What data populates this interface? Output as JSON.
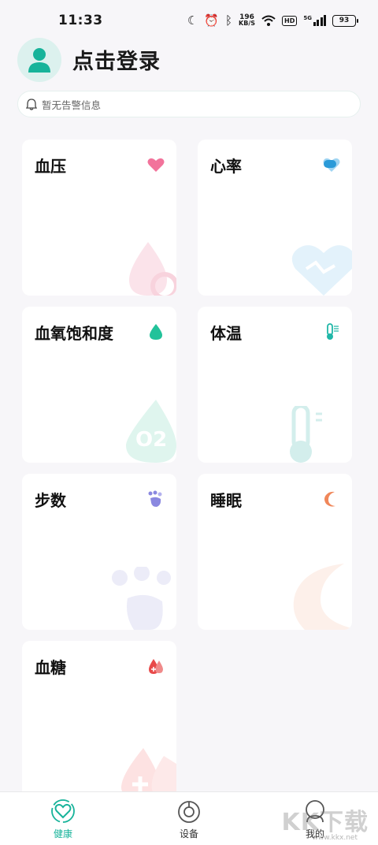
{
  "status_bar": {
    "time": "11:33",
    "net_speed_value": "196",
    "net_speed_unit": "KB/S",
    "hd_label": "HD",
    "network_label": "5G",
    "battery": "93",
    "icons": [
      "moon-icon",
      "alarm-icon",
      "bluetooth-icon",
      "wifi-icon",
      "signal-icon",
      "battery-icon"
    ]
  },
  "header": {
    "login_label": "点击登录",
    "avatar_icon": "user-icon"
  },
  "alert": {
    "text": "暂无告警信息",
    "icon": "bell-icon"
  },
  "cards": [
    {
      "title": "血压",
      "icon": "heart-icon",
      "accent": "#f05a8a"
    },
    {
      "title": "心率",
      "icon": "heart-rate-icon",
      "accent": "#2a9ad8"
    },
    {
      "title": "血氧饱和度",
      "icon": "oxygen-drop-icon",
      "accent": "#22c29a"
    },
    {
      "title": "体温",
      "icon": "thermometer-icon",
      "accent": "#20b7a8"
    },
    {
      "title": "步数",
      "icon": "footprint-icon",
      "accent": "#8a88e0"
    },
    {
      "title": "睡眠",
      "icon": "moon-icon",
      "accent": "#f0875a"
    },
    {
      "title": "血糖",
      "icon": "blood-sugar-icon",
      "accent": "#e84a4a"
    }
  ],
  "deco": {
    "oxygen_symbol": "O2"
  },
  "bottom_nav": {
    "items": [
      {
        "label": "健康",
        "icon": "health-heart-icon",
        "active": true
      },
      {
        "label": "设备",
        "icon": "device-icon",
        "active": false
      },
      {
        "label": "我的",
        "icon": "profile-icon",
        "active": false
      }
    ],
    "active_color": "#17b39a"
  },
  "watermark": {
    "text": "KK下载",
    "url": "www.kkx.net"
  }
}
